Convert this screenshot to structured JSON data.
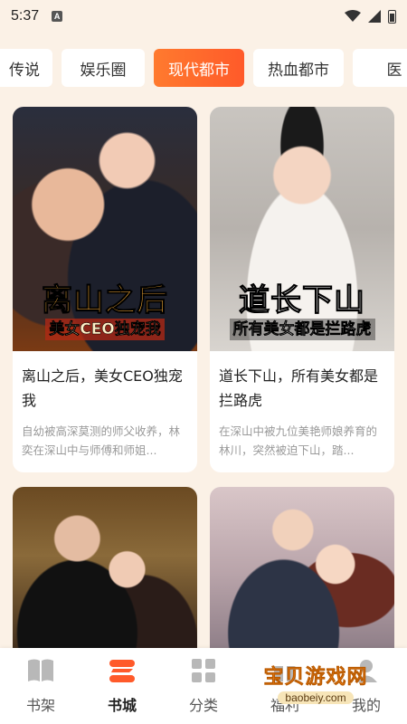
{
  "status_bar": {
    "time": "5:37",
    "notif_badge": "A"
  },
  "tabs": [
    {
      "label": "传说",
      "active": false
    },
    {
      "label": "娱乐圈",
      "active": false
    },
    {
      "label": "现代都市",
      "active": true
    },
    {
      "label": "热血都市",
      "active": false
    },
    {
      "label": "医",
      "active": false
    }
  ],
  "books": [
    {
      "cover_line1": "离山之后",
      "cover_line2": "美女CEO独宠我",
      "title": "离山之后，美女CEO独宠我",
      "desc": "自幼被高深莫测的师父收养，林奕在深山中与师傅和师姐..."
    },
    {
      "cover_line1": "道长下山",
      "cover_line2": "所有美女都是拦路虎",
      "title": "道长下山，所有美女都是拦路虎",
      "desc": "在深山中被九位美艳师娘养育的林川，突然被迫下山，踏..."
    },
    {},
    {}
  ],
  "bottom_nav": [
    {
      "label": "书架",
      "icon": "book-icon",
      "active": false
    },
    {
      "label": "书城",
      "icon": "bookstore-icon",
      "active": true
    },
    {
      "label": "分类",
      "icon": "grid-icon",
      "active": false
    },
    {
      "label": "福利",
      "icon": "gift-icon",
      "active": false
    },
    {
      "label": "我的",
      "icon": "user-icon",
      "active": false
    }
  ],
  "watermark": {
    "text": "宝贝游戏网",
    "url": "baobeiy.com"
  },
  "colors": {
    "accent": "#ff6a2c",
    "background": "#fbf1e6",
    "card": "#ffffff"
  }
}
